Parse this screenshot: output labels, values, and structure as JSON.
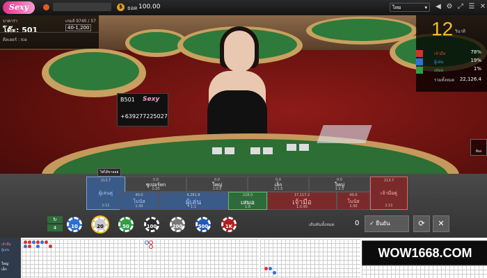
{
  "topbar": {
    "logo": "Sexy",
    "currency": "ยอด",
    "balance": "100.00",
    "language": "ไทย"
  },
  "table_info": {
    "game_type": "บาคาร่า",
    "table_name": "โต๊ะ: 501",
    "round": "เกมส์ 9740 / 57",
    "limit": "40-1,200",
    "dealer_label": "ดีลเลอร์ : Ice"
  },
  "sign": {
    "table": "B501",
    "brand": "Sexy",
    "phone": "+639277225027"
  },
  "countdown": {
    "value": "12",
    "unit": "วินาที"
  },
  "stats": [
    {
      "label": "เจ้ามือ",
      "value": "78%",
      "color": "#d83030"
    },
    {
      "label": "ผู้เล่น",
      "value": "19%",
      "color": "#3070d8"
    },
    {
      "label": "เสมอ",
      "value": "1%",
      "color": "#30a040"
    }
  ],
  "stats_total": {
    "label": "รวมทั้งหมด",
    "value": "22,126.4"
  },
  "side_button": "ห้อง",
  "bet_zones": {
    "top": [
      {
        "amount": "213.7",
        "name": "ผู้เล่นคู่",
        "odds": "1:11"
      },
      {
        "amount": "0.0",
        "name": "ซูเปอร์หก",
        "odds": "1:20"
      },
      {
        "amount": "0.0",
        "name": "ใหญ่",
        "odds": "1:0.5"
      },
      {
        "amount": "0.0",
        "name": "เล็ก",
        "odds": "1:1.5"
      },
      {
        "amount": "0.0",
        "name": "ใหญ่",
        "odds": "1:1.5"
      },
      {
        "amount": "213.7",
        "name": "เจ้ามือคู่",
        "odds": "1:11"
      }
    ],
    "bottom": [
      {
        "amount": "40.0",
        "name": "โบนัส",
        "odds": "1:30"
      },
      {
        "amount": "4,281.8",
        "name": "ผู้เล่น",
        "odds": "1:1"
      },
      {
        "amount": "228.0",
        "name": "เสมอ",
        "odds": "1:8"
      },
      {
        "amount": "17,117.2",
        "name": "เจ้ามือ",
        "odds": "1:0.95"
      },
      {
        "amount": "40.0",
        "name": "โบนัส",
        "odds": "1:30"
      }
    ],
    "tab": "ไพ่ได้ขาลอย"
  },
  "chips": [
    {
      "label": "10",
      "color": "#2c6fd1"
    },
    {
      "label": "20",
      "color": "#c9c9c9"
    },
    {
      "label": "50",
      "color": "#2f9e45"
    },
    {
      "label": "100",
      "color": "#2a2a2a"
    },
    {
      "label": "200",
      "color": "#777777"
    },
    {
      "label": "500",
      "color": "#2458b5"
    },
    {
      "label": "1K",
      "color": "#b21d1d"
    }
  ],
  "chip_controls": {
    "count": "4"
  },
  "bet_total": {
    "label": "เดิมพันทั้งหมด",
    "value": "0"
  },
  "confirm_label": "ยืนยัน",
  "road": {
    "side_items": [
      "เจ้ามือ",
      "ผู้เล่น",
      "ใหญ่",
      "เล็ก"
    ]
  },
  "watermark": "WOW1668.COM"
}
